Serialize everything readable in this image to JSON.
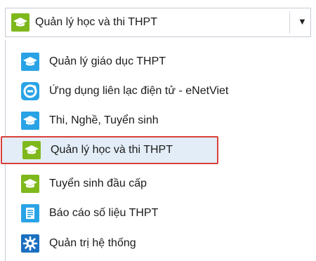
{
  "dropdown": {
    "selected_label": "Quản lý học và thi THPT",
    "selected_icon": "graduation-cap-icon",
    "arrow_icon": "caret-down-icon"
  },
  "menu": {
    "items": [
      {
        "label": "Quản lý giáo dục THPT",
        "icon": "graduation-cap-icon",
        "color": "#2aa3e6"
      },
      {
        "label": "Ứng dụng liên lạc điện tử - eNetViet",
        "icon": "enetviet-icon",
        "color": "#2aa3e6"
      },
      {
        "label": "Thi, Nghề, Tuyển sinh",
        "icon": "graduation-cap-icon",
        "color": "#2aa3e6"
      },
      {
        "label": "Quản lý học và thi THPT",
        "icon": "graduation-cap-icon",
        "color": "#7fb81c",
        "selected": true
      },
      {
        "label": "Tuyển sinh đầu cấp",
        "icon": "graduation-cap-icon",
        "color": "#7fb81c"
      },
      {
        "label": "Báo cáo số liệu THPT",
        "icon": "document-icon",
        "color": "#2aa3e6"
      },
      {
        "label": "Quản trị hệ thống",
        "icon": "gear-icon",
        "color": "#1b6fc0"
      }
    ]
  },
  "colors": {
    "selection_border": "#d9403b",
    "selection_fill": "#e3edf7"
  }
}
